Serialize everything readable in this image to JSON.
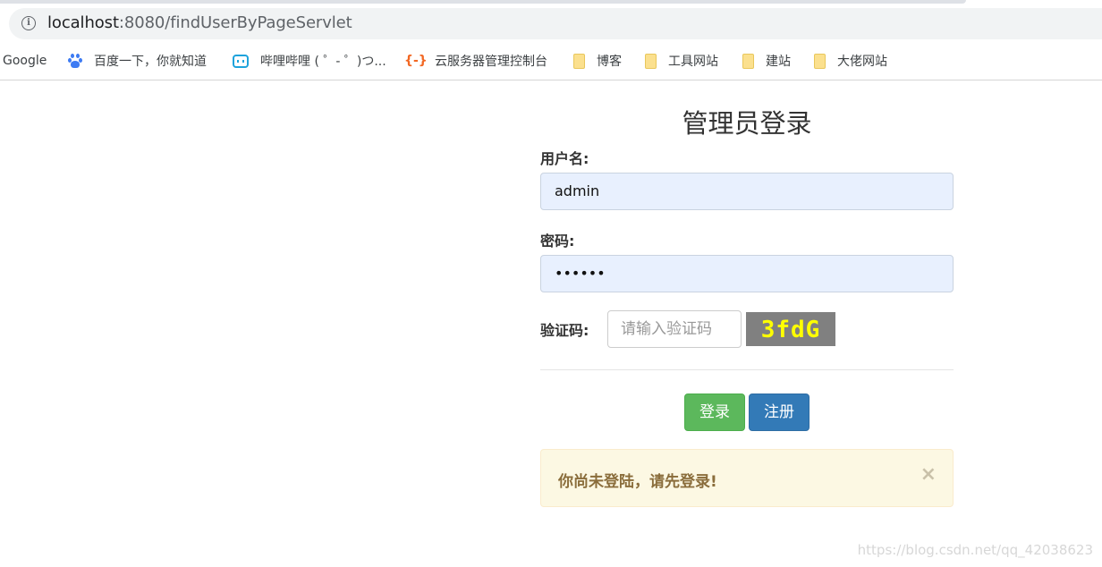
{
  "browser": {
    "url_host": "localhost",
    "url_rest": ":8080/findUserByPageServlet",
    "bookmarks": [
      {
        "label": "Google",
        "icon": "none"
      },
      {
        "label": "百度一下，你就知道",
        "icon": "baidu-icon"
      },
      {
        "label": "哔哩哔哩 ( ゜- ゜)つ...",
        "icon": "bilibili-icon"
      },
      {
        "label": "云服务器管理控制台",
        "icon": "aliyun-icon"
      },
      {
        "label": "博客",
        "icon": "folder-icon"
      },
      {
        "label": "工具网站",
        "icon": "folder-icon"
      },
      {
        "label": "建站",
        "icon": "folder-icon"
      },
      {
        "label": "大佬网站",
        "icon": "folder-icon"
      }
    ],
    "aliyun_glyph": "{-}"
  },
  "page": {
    "title": "管理员登录",
    "username_label": "用户名:",
    "username_value": "admin",
    "password_label": "密码:",
    "password_value": "••••••",
    "captcha_label": "验证码:",
    "captcha_placeholder": "请输入验证码",
    "captcha_text": "3fdG",
    "login_button": "登录",
    "register_button": "注册",
    "alert_text": "你尚未登陆，请先登录!",
    "alert_close": "×",
    "watermark": "https://blog.csdn.net/qq_42038623"
  },
  "colors": {
    "login_green": "#5cb85c",
    "register_blue": "#337ab7",
    "alert_bg": "#fcf8e3",
    "autofill_bg": "#e8f0fe",
    "captcha_fg": "#ffff00",
    "captcha_bg": "#808080"
  }
}
